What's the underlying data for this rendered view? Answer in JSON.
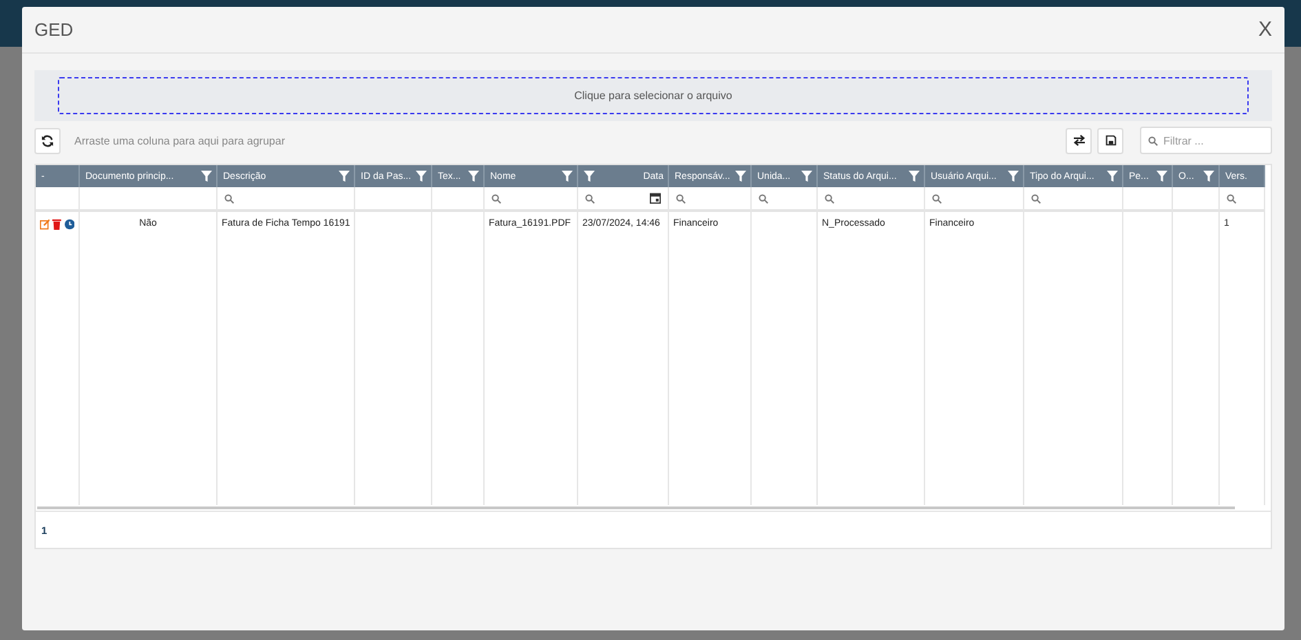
{
  "dialog": {
    "title": "GED",
    "close": "X"
  },
  "upload": {
    "label": "Clique para selecionar o arquivo"
  },
  "toolbar": {
    "group_hint": "Arraste uma coluna para aqui para agrupar",
    "search": {
      "placeholder": "Filtrar ..."
    }
  },
  "table": {
    "columns": [
      {
        "label": "-",
        "filter": false,
        "search": false,
        "calendar": false
      },
      {
        "label": "Documento princip...",
        "filter": true,
        "search": false,
        "calendar": false
      },
      {
        "label": "Descrição",
        "filter": true,
        "search": true,
        "calendar": false
      },
      {
        "label": "ID da Pas...",
        "filter": true,
        "search": false,
        "calendar": false
      },
      {
        "label": "Tex...",
        "filter": true,
        "search": false,
        "calendar": false
      },
      {
        "label": "Nome",
        "filter": true,
        "search": true,
        "calendar": false
      },
      {
        "label": "Data",
        "filter": true,
        "search": true,
        "calendar": true
      },
      {
        "label": "Responsáv...",
        "filter": true,
        "search": true,
        "calendar": false
      },
      {
        "label": "Unida...",
        "filter": true,
        "search": true,
        "calendar": false
      },
      {
        "label": "Status do Arqui...",
        "filter": true,
        "search": true,
        "calendar": false
      },
      {
        "label": "Usuário Arqui...",
        "filter": true,
        "search": true,
        "calendar": false
      },
      {
        "label": "Tipo do Arqui...",
        "filter": true,
        "search": true,
        "calendar": false
      },
      {
        "label": "Pe...",
        "filter": true,
        "search": false,
        "calendar": false
      },
      {
        "label": "O...",
        "filter": true,
        "search": false,
        "calendar": false
      },
      {
        "label": "Vers.",
        "filter": false,
        "search": true,
        "calendar": false
      }
    ],
    "rows": [
      {
        "cells": [
          "",
          "Não",
          "Fatura de Ficha Tempo 16191",
          "",
          "",
          "Fatura_16191.PDF",
          "23/07/2024, 14:46",
          "Financeiro",
          "",
          "N_Processado",
          "Financeiro",
          "",
          "",
          "",
          "1"
        ]
      }
    ]
  },
  "pager": {
    "pages": [
      {
        "label": "1",
        "selected": true
      }
    ]
  }
}
